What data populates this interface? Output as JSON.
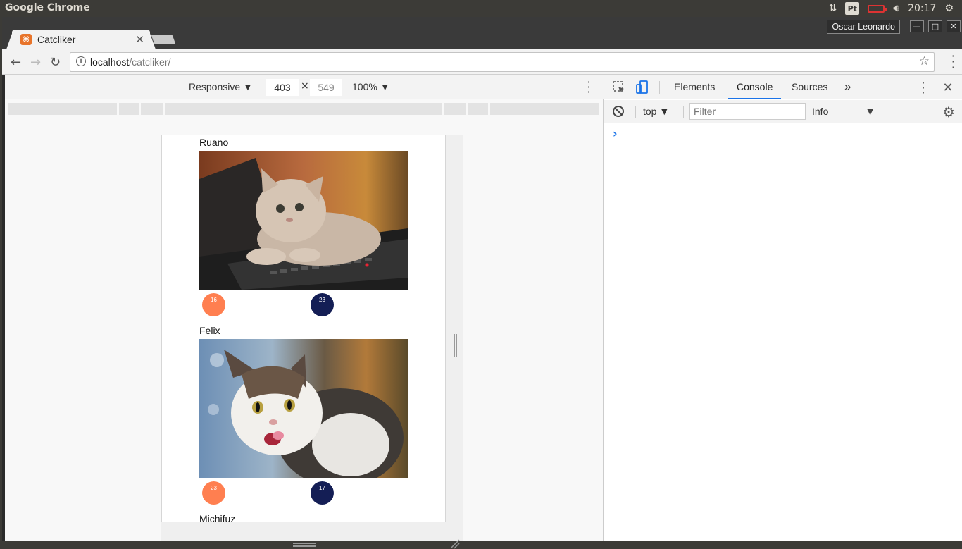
{
  "os": {
    "app_name": "Google Chrome",
    "clock": "20:17",
    "keyboard_layout": "Pt"
  },
  "browser": {
    "tab_title": "Catcliker",
    "profile_name": "Oscar Leonardo",
    "url_host": "localhost",
    "url_path": "/catcliker/"
  },
  "device_toolbar": {
    "mode": "Responsive",
    "width": "403",
    "height": "549",
    "zoom": "100%",
    "times": "×"
  },
  "page": {
    "cats": [
      {
        "name": "Ruano",
        "up_votes": "16",
        "down_votes": "23"
      },
      {
        "name": "Felix",
        "up_votes": "23",
        "down_votes": "17"
      },
      {
        "name": "Michifuz"
      }
    ]
  },
  "devtools": {
    "tabs": [
      "Elements",
      "Console",
      "Sources"
    ],
    "active_tab": "Console",
    "more_tabs": "»",
    "context": "top",
    "filter_placeholder": "Filter",
    "level": "Info",
    "prompt": "›"
  },
  "colors": {
    "up_vote": "#ff7f50",
    "down_vote": "#141e55",
    "active_tab_underline": "#1a73e8"
  }
}
